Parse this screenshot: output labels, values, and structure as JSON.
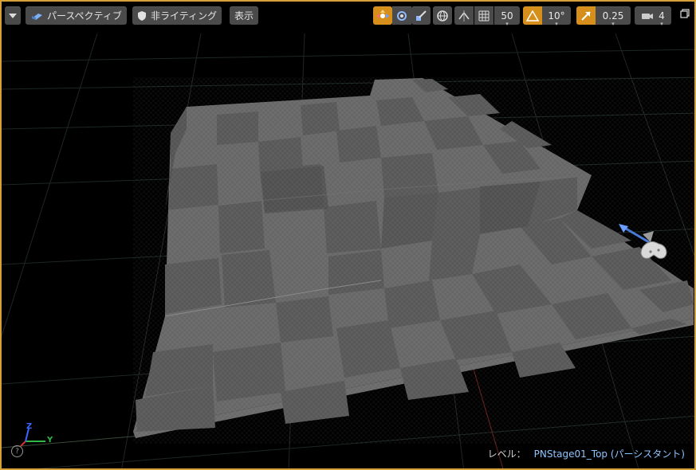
{
  "toolbar": {
    "perspective_label": "パースペクティブ",
    "lighting_label": "非ライティング",
    "show_label": "表示",
    "grid_snap_value": "50",
    "rotation_snap_value": "10°",
    "scale_snap_value": "0.25",
    "camera_speed_value": "4"
  },
  "status": {
    "level_prefix": "レベル：",
    "level_name": "PNStage01_Top (パーシスタント)"
  },
  "axes": {
    "z_label": "Z",
    "y_label": "Y"
  },
  "colors": {
    "viewport_border": "#d7a13a",
    "active_tool": "#d58f1a",
    "grid_line": "#1e2626",
    "floor_light": "#7a7a7a",
    "floor_dark": "#555555"
  },
  "icons": {
    "dropdown": "chevron-down-icon",
    "perspective": "perspective-cube-icon",
    "lighting": "shield-icon",
    "translate": "translate-move-icon",
    "rotate": "rotate-icon",
    "scale": "scale-icon",
    "world": "globe-icon",
    "surface": "surface-snap-icon",
    "grid": "grid-icon",
    "angle": "angle-snap-icon",
    "scale_snap": "scale-snap-icon",
    "camera": "camera-speed-icon",
    "maximize": "maximize-icon",
    "help": "help-icon"
  }
}
